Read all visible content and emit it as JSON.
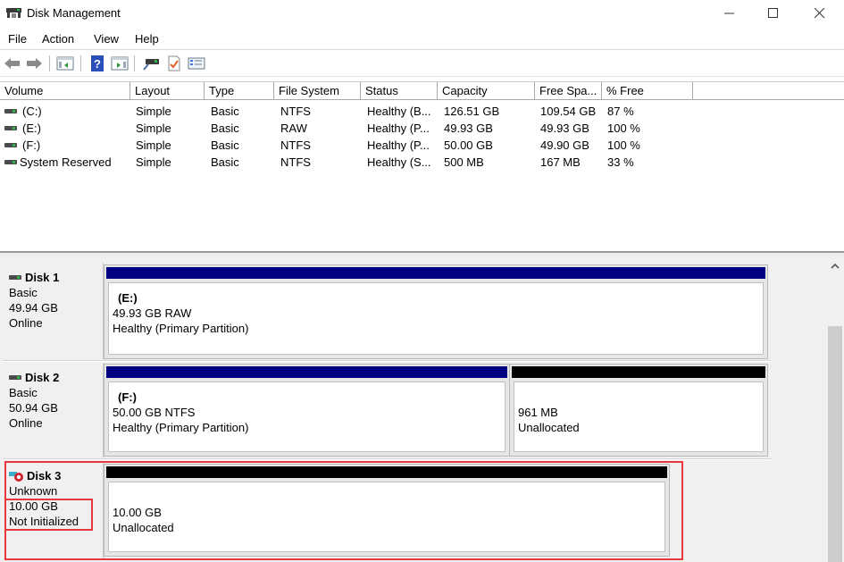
{
  "window": {
    "title": "Disk Management",
    "app_icon": "disk-management-icon",
    "controls": {
      "minimize": "—",
      "maximize": "☐",
      "close": "✕"
    }
  },
  "menu": [
    "File",
    "Action",
    "View",
    "Help"
  ],
  "toolbar": {
    "buttons": [
      {
        "name": "back-button",
        "icon": "back-arrow-icon"
      },
      {
        "name": "forward-button",
        "icon": "forward-arrow-icon"
      },
      {
        "name": "show-hide-console-tree-button",
        "icon": "console-tree-icon"
      },
      {
        "name": "help-button",
        "icon": "help-icon"
      },
      {
        "name": "show-hide-action-pane-button",
        "icon": "action-pane-icon"
      },
      {
        "name": "connect-disk-button",
        "icon": "connect-icon"
      },
      {
        "name": "properties-button",
        "icon": "properties-icon"
      },
      {
        "name": "settings-button",
        "icon": "list-settings-icon"
      }
    ]
  },
  "volume_table": {
    "columns": [
      "Volume",
      "Layout",
      "Type",
      "File System",
      "Status",
      "Capacity",
      "Free Spa...",
      "% Free"
    ],
    "rows": [
      {
        "volume": "(C:)",
        "layout": "Simple",
        "type": "Basic",
        "fs": "NTFS",
        "status": "Healthy (B...",
        "capacity": "126.51 GB",
        "free": "109.54 GB",
        "pct": "87 %"
      },
      {
        "volume": "(E:)",
        "layout": "Simple",
        "type": "Basic",
        "fs": "RAW",
        "status": "Healthy (P...",
        "capacity": "49.93 GB",
        "free": "49.93 GB",
        "pct": "100 %"
      },
      {
        "volume": "(F:)",
        "layout": "Simple",
        "type": "Basic",
        "fs": "NTFS",
        "status": "Healthy (P...",
        "capacity": "50.00 GB",
        "free": "49.90 GB",
        "pct": "100 %"
      },
      {
        "volume": "System Reserved",
        "layout": "Simple",
        "type": "Basic",
        "fs": "NTFS",
        "status": "Healthy (S...",
        "capacity": "500 MB",
        "free": "167 MB",
        "pct": "33 %"
      }
    ]
  },
  "disks": [
    {
      "name": "Disk 1",
      "type": "Basic",
      "size": "49.94 GB",
      "state": "Online",
      "icon": "disk-online-icon",
      "partitions": [
        {
          "label": "(E:)",
          "size": "49.93 GB RAW",
          "status": "Healthy (Primary Partition)",
          "bar_color": "#000080"
        }
      ]
    },
    {
      "name": "Disk 2",
      "type": "Basic",
      "size": "50.94 GB",
      "state": "Online",
      "icon": "disk-online-icon",
      "partitions": [
        {
          "label": "(F:)",
          "size": "50.00 GB NTFS",
          "status": "Healthy (Primary Partition)",
          "bar_color": "#000080"
        },
        {
          "label": "",
          "size": "961 MB",
          "status": "Unallocated",
          "bar_color": "#000000"
        }
      ]
    },
    {
      "name": "Disk 3",
      "type": "Unknown",
      "size": "10.00 GB",
      "state": "Not Initialized",
      "icon": "disk-not-initialized-icon",
      "partitions": [
        {
          "label": "",
          "size": "10.00 GB",
          "status": "Unallocated",
          "bar_color": "#000000"
        }
      ]
    }
  ],
  "colors": {
    "primary_partition": "#000080",
    "unallocated": "#000000",
    "highlight": "#e8383d"
  }
}
